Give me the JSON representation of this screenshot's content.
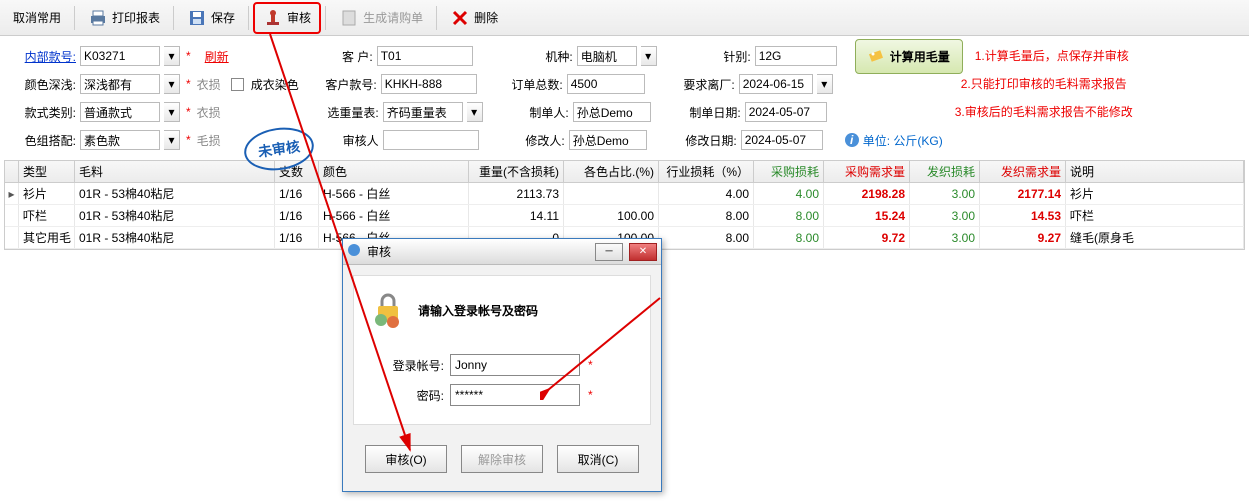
{
  "toolbar": {
    "cancel": "取消常用",
    "print": "打印报表",
    "save": "保存",
    "audit": "审核",
    "generate": "生成请购单",
    "delete": "删除"
  },
  "form": {
    "internal_lbl": "内部款号:",
    "internal_val": "K03271",
    "refresh": "刷新",
    "depth_lbl": "颜色深浅:",
    "depth_val": "深浅都有",
    "yiloss1": "衣损",
    "chengyi": "成衣染色",
    "style_lbl": "款式类别:",
    "style_val": "普通款式",
    "yiloss2": "衣损",
    "group_lbl": "色组搭配:",
    "group_val": "素色款",
    "maoloss": "毛损",
    "cust_lbl": "客   户:",
    "cust_val": "T01",
    "custno_lbl": "客户款号:",
    "custno_val": "KHKH-888",
    "weightsel_lbl": "选重量表:",
    "weightsel_val": "齐码重量表",
    "reviewer_lbl": "审核人",
    "reviewer_val": "",
    "machine_lbl": "机种:",
    "machine_val": "电脑机",
    "ordertotal_lbl": "订单总数:",
    "ordertotal_val": "4500",
    "maker_lbl": "制单人:",
    "maker_val": "孙总Demo",
    "modifier_lbl": "修改人:",
    "modifier_val": "孙总Demo",
    "needle_lbl": "针别:",
    "needle_val": "12G",
    "leave_lbl": "要求离厂:",
    "leave_val": "2024-06-15",
    "makedate_lbl": "制单日期:",
    "makedate_val": "2024-05-07",
    "moddate_lbl": "修改日期:",
    "moddate_val": "2024-05-07",
    "calc": "计算用毛量",
    "note1": "1.计算毛量后，点保存并审核",
    "note2": "2.只能打印审核的毛料需求报告",
    "note3": "3.审核后的毛料需求报告不能修改",
    "unit": "单位: 公斤(KG)",
    "stamp": "未审核"
  },
  "headers": {
    "type": "类型",
    "wool": "毛料",
    "zhi": "支数",
    "color": "颜色",
    "weight": "重量(不含损耗)",
    "ratio": "各色占比.(%)",
    "loss": "行业损耗（%）",
    "ploss": "采购损耗",
    "preq": "采购需求量",
    "floss": "发织损耗",
    "freq": "发织需求量",
    "desc": "说明"
  },
  "rows": [
    {
      "type": "衫片",
      "wool": "01R - 53棉40粘尼",
      "zhi": "1/16",
      "color": "H-566 - 白丝",
      "weight": "2113.73",
      "ratio": "",
      "loss": "4.00",
      "ploss": "4.00",
      "preq": "2198.28",
      "floss": "3.00",
      "freq": "2177.14",
      "desc": "衫片"
    },
    {
      "type": "吓栏",
      "wool": "01R - 53棉40粘尼",
      "zhi": "1/16",
      "color": "H-566 - 白丝",
      "weight": "14.11",
      "ratio": "100.00",
      "loss": "8.00",
      "ploss": "8.00",
      "preq": "15.24",
      "floss": "3.00",
      "freq": "14.53",
      "desc": "吓栏"
    },
    {
      "type": "其它用毛",
      "wool": "01R - 53棉40粘尼",
      "zhi": "1/16",
      "color": "H-566 - 白丝",
      "weight": "0",
      "ratio": "100.00",
      "loss": "8.00",
      "ploss": "8.00",
      "preq": "9.72",
      "floss": "3.00",
      "freq": "9.27",
      "desc": "缝毛(原身毛"
    }
  ],
  "dialog": {
    "title": "审核",
    "prompt": "请输入登录帐号及密码",
    "acct_lbl": "登录帐号:",
    "acct_val": "Jonny",
    "pwd_lbl": "密码:",
    "pwd_val": "******",
    "audit": "审核(O)",
    "unaudit": "解除审核",
    "cancel": "取消(C)"
  }
}
